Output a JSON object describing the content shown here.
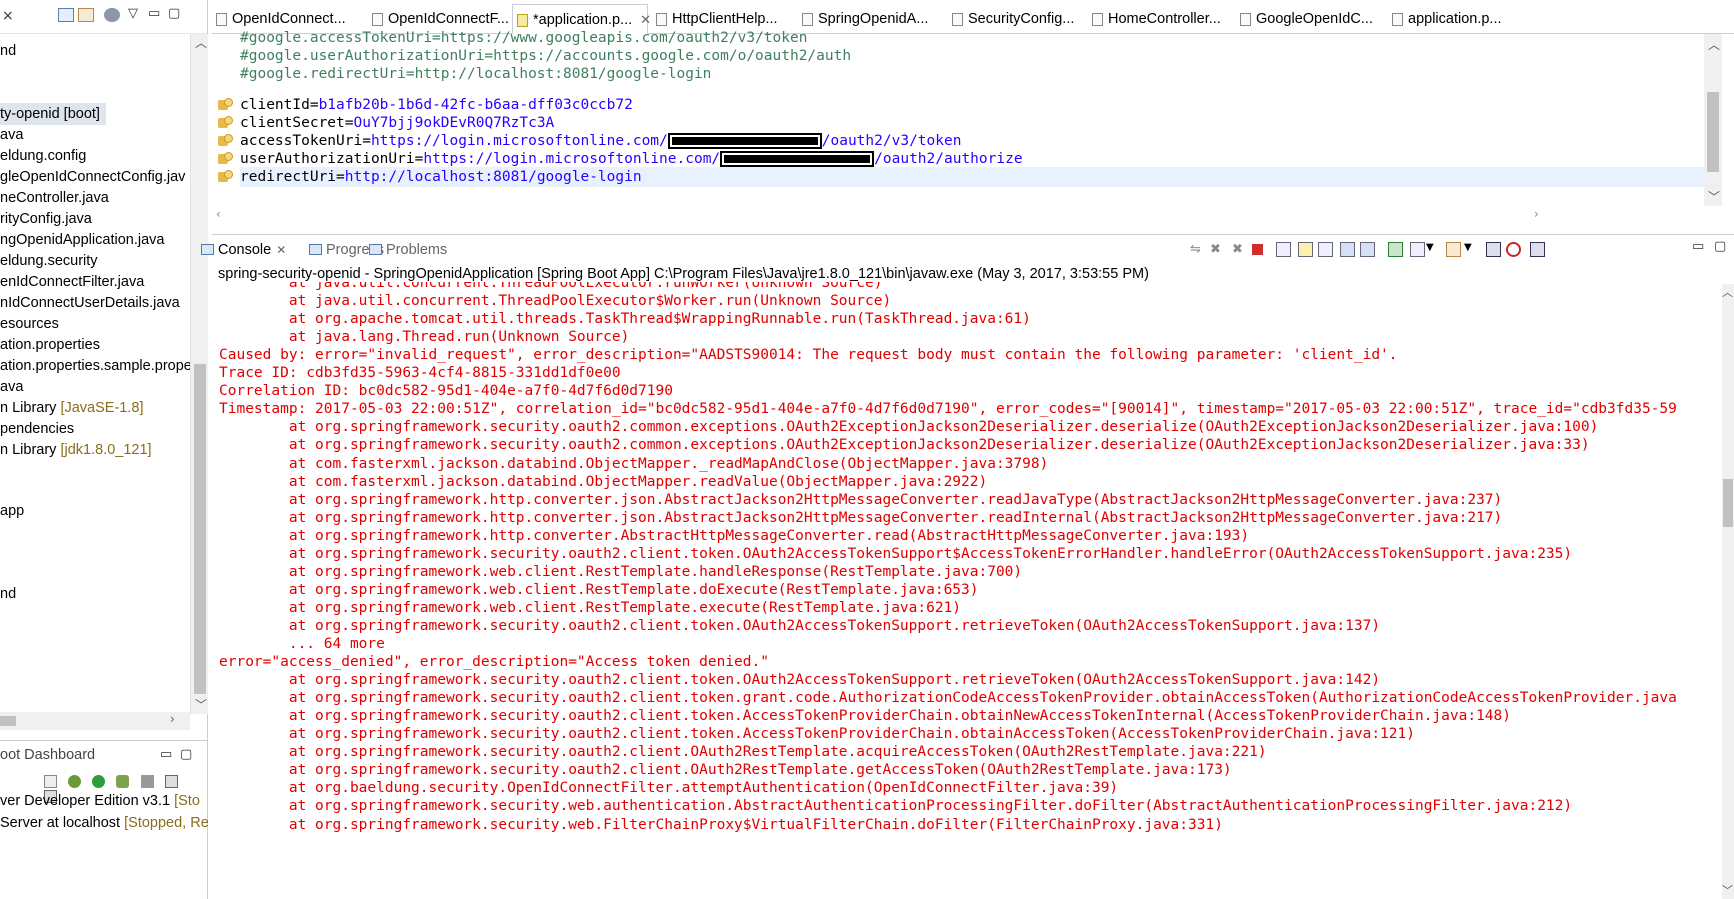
{
  "left_panel": {
    "close_glyph": "×",
    "tree_items": [
      {
        "text": "nd"
      },
      {
        "text": "ty-openid [boot]",
        "selected": true
      },
      {
        "text": "ava"
      },
      {
        "text": "eldung.config"
      },
      {
        "text": "gleOpenIdConnectConfig.jav"
      },
      {
        "text": "neController.java"
      },
      {
        "text": "rityConfig.java"
      },
      {
        "text": "ngOpenidApplication.java"
      },
      {
        "text": "eldung.security"
      },
      {
        "text": "enIdConnectFilter.java"
      },
      {
        "text": "nIdConnectUserDetails.java"
      },
      {
        "text": "esources"
      },
      {
        "text": "ation.properties"
      },
      {
        "text": "ation.properties.sample.prope"
      },
      {
        "text": "ava"
      },
      {
        "text": "n Library ",
        "decoration": "[JavaSE-1.8]"
      },
      {
        "text": "pendencies"
      },
      {
        "text": "n Library ",
        "decoration": "[jdk1.8.0_121]"
      },
      {
        "text": "app"
      },
      {
        "text": "nd"
      }
    ]
  },
  "boot_dashboard": {
    "title": "oot Dashboard",
    "items": [
      {
        "text": "ver Developer Edition v3.1 ",
        "status": "[Sto"
      },
      {
        "text": "Server at localhost ",
        "status": "[Stopped, Re"
      }
    ]
  },
  "editor_tabs": [
    {
      "label": "OpenIdConnect...",
      "active": false
    },
    {
      "label": "OpenIdConnectF...",
      "active": false
    },
    {
      "label": "*application.p...",
      "active": true
    },
    {
      "label": "HttpClientHelp...",
      "active": false
    },
    {
      "label": "SpringOpenidA...",
      "active": false
    },
    {
      "label": "SecurityConfig...",
      "active": false
    },
    {
      "label": "HomeController...",
      "active": false
    },
    {
      "label": "GoogleOpenIdC...",
      "active": false
    },
    {
      "label": "application.p...",
      "active": false
    }
  ],
  "editor": {
    "comment_lines": [
      "#google.accessTokenUri=https://www.googleapis.com/oauth2/v3/token",
      "#google.userAuthorizationUri=https://accounts.google.com/o/oauth2/auth",
      "#google.redirectUri=http://localhost:8081/google-login"
    ],
    "properties": [
      {
        "key": "clientId",
        "value": "b1afb20b-1b6d-42fc-b6aa-dff03c0ccb72"
      },
      {
        "key": "clientSecret",
        "value": "OuY7bjj9okDEvR0Q7RzTc3A"
      },
      {
        "key": "accessTokenUri",
        "value": "https://login.microsoftonline.com/",
        "suffix": "/oauth2/v3/token"
      },
      {
        "key": "userAuthorizationUri",
        "value": "https://login.microsoftonline.com/",
        "suffix": "/oauth2/authorize"
      },
      {
        "key": "redirectUri",
        "value": "http://localhost:8081/google-login"
      }
    ]
  },
  "console": {
    "tabs": [
      {
        "label": "Console",
        "active": true
      },
      {
        "label": "Progress",
        "active": false
      },
      {
        "label": "Problems",
        "active": false
      }
    ],
    "title": "spring-security-openid - SpringOpenidApplication [Spring Boot App] C:\\Program Files\\Java\\jre1.8.0_121\\bin\\javaw.exe (May 3, 2017, 3:53:55 PM)",
    "lines": [
      "        at java.util.concurrent.ThreadPoolExecutor.runWorker(Unknown Source)",
      "        at java.util.concurrent.ThreadPoolExecutor$Worker.run(Unknown Source)",
      "        at org.apache.tomcat.util.threads.TaskThread$WrappingRunnable.run(TaskThread.java:61)",
      "        at java.lang.Thread.run(Unknown Source)",
      "Caused by: error=\"invalid_request\", error_description=\"AADSTS90014: The request body must contain the following parameter: 'client_id'.",
      "Trace ID: cdb3fd35-5963-4cf4-8815-331dd1df0e00",
      "Correlation ID: bc0dc582-95d1-404e-a7f0-4d7f6d0d7190",
      "Timestamp: 2017-05-03 22:00:51Z\", correlation_id=\"bc0dc582-95d1-404e-a7f0-4d7f6d0d7190\", error_codes=\"[90014]\", timestamp=\"2017-05-03 22:00:51Z\", trace_id=\"cdb3fd35-59",
      "        at org.springframework.security.oauth2.common.exceptions.OAuth2ExceptionJackson2Deserializer.deserialize(OAuth2ExceptionJackson2Deserializer.java:100)",
      "        at org.springframework.security.oauth2.common.exceptions.OAuth2ExceptionJackson2Deserializer.deserialize(OAuth2ExceptionJackson2Deserializer.java:33)",
      "        at com.fasterxml.jackson.databind.ObjectMapper._readMapAndClose(ObjectMapper.java:3798)",
      "        at com.fasterxml.jackson.databind.ObjectMapper.readValue(ObjectMapper.java:2922)",
      "        at org.springframework.http.converter.json.AbstractJackson2HttpMessageConverter.readJavaType(AbstractJackson2HttpMessageConverter.java:237)",
      "        at org.springframework.http.converter.json.AbstractJackson2HttpMessageConverter.readInternal(AbstractJackson2HttpMessageConverter.java:217)",
      "        at org.springframework.http.converter.AbstractHttpMessageConverter.read(AbstractHttpMessageConverter.java:193)",
      "        at org.springframework.security.oauth2.client.token.OAuth2AccessTokenSupport$AccessTokenErrorHandler.handleError(OAuth2AccessTokenSupport.java:235)",
      "        at org.springframework.web.client.RestTemplate.handleResponse(RestTemplate.java:700)",
      "        at org.springframework.web.client.RestTemplate.doExecute(RestTemplate.java:653)",
      "        at org.springframework.web.client.RestTemplate.execute(RestTemplate.java:621)",
      "        at org.springframework.security.oauth2.client.token.OAuth2AccessTokenSupport.retrieveToken(OAuth2AccessTokenSupport.java:137)",
      "        ... 64 more",
      "error=\"access_denied\", error_description=\"Access token denied.\"",
      "        at org.springframework.security.oauth2.client.token.OAuth2AccessTokenSupport.retrieveToken(OAuth2AccessTokenSupport.java:142)",
      "        at org.springframework.security.oauth2.client.token.grant.code.AuthorizationCodeAccessTokenProvider.obtainAccessToken(AuthorizationCodeAccessTokenProvider.java",
      "        at org.springframework.security.oauth2.client.token.AccessTokenProviderChain.obtainNewAccessTokenInternal(AccessTokenProviderChain.java:148)",
      "        at org.springframework.security.oauth2.client.token.AccessTokenProviderChain.obtainAccessToken(AccessTokenProviderChain.java:121)",
      "        at org.springframework.security.oauth2.client.OAuth2RestTemplate.acquireAccessToken(OAuth2RestTemplate.java:221)",
      "        at org.springframework.security.oauth2.client.OAuth2RestTemplate.getAccessToken(OAuth2RestTemplate.java:173)",
      "        at org.baeldung.security.OpenIdConnectFilter.attemptAuthentication(OpenIdConnectFilter.java:39)",
      "        at org.springframework.security.web.authentication.AbstractAuthenticationProcessingFilter.doFilter(AbstractAuthenticationProcessingFilter.java:212)",
      "        at org.springframework.security.web.FilterChainProxy$VirtualFilterChain.doFilter(FilterChainProxy.java:331)"
    ]
  },
  "colors": {
    "error_text": "#e00000",
    "comment": "#3f7f5f",
    "property_value": "#2a00ff",
    "decoration": "#8a6d1a",
    "selection": "#dfe5ee"
  }
}
